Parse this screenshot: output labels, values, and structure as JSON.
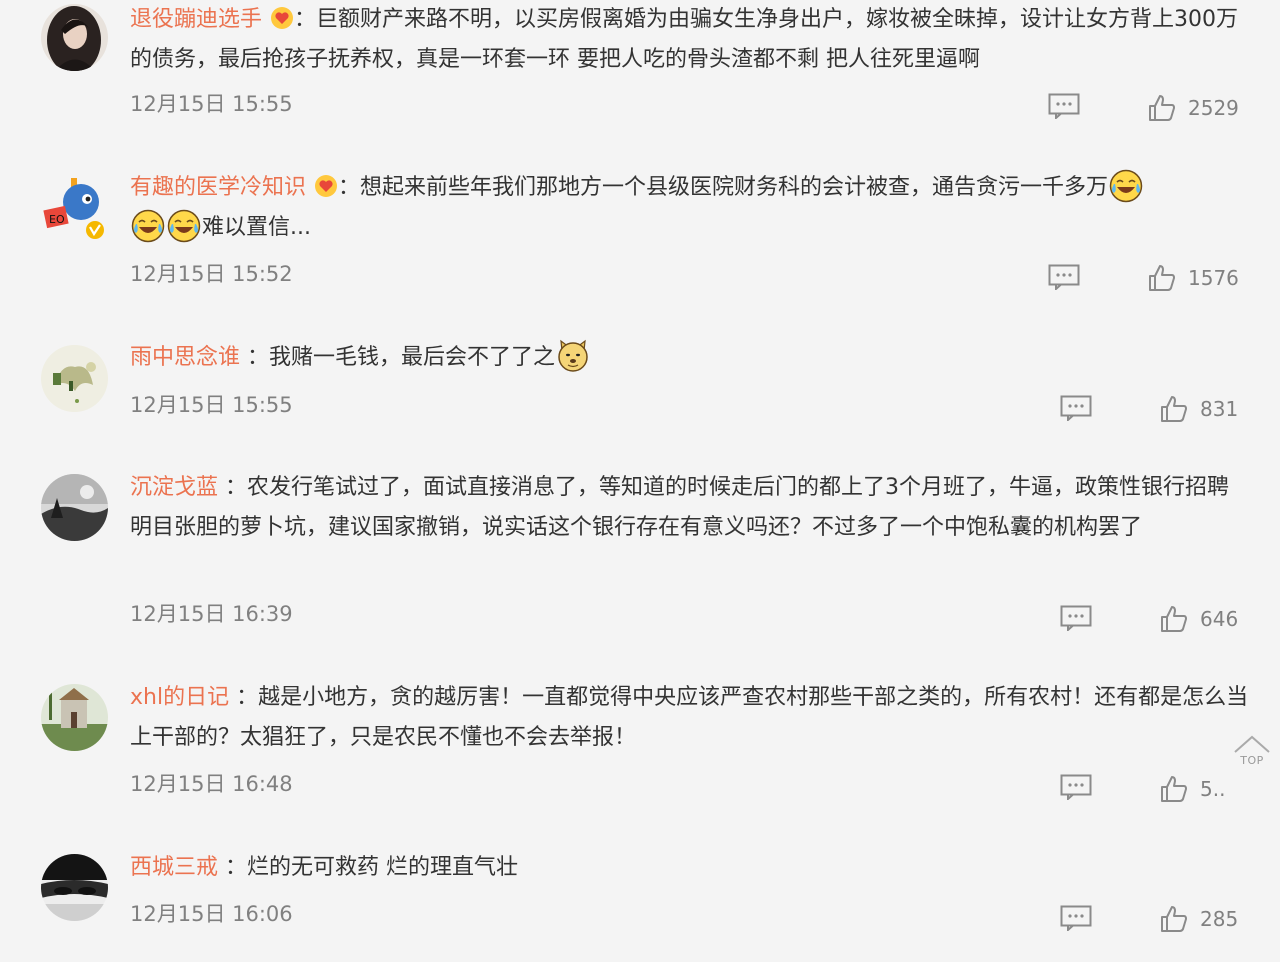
{
  "comments": [
    {
      "username": "退役蹦迪选手",
      "text_pre": "：巨额财产来路不明，以买房假离婚为由骗女生净身出户，嫁妆被全昧掉，设计让女方背上300万的债务，最后抢孩子抚养权，真是一环套一环 要把人吃的骨头渣都不剩 把人往死里逼啊",
      "time": "12月15日 15:55",
      "likes": "2529"
    },
    {
      "username": "有趣的医学冷知识",
      "text_pre": "：想起来前些年我们那地方一个县级医院财务科的会计被查，通告贪污一千多万",
      "text_post": "难以置信...",
      "time": "12月15日 15:52",
      "likes": "1576"
    },
    {
      "username": "雨中思念谁",
      "text_pre": "：我赌一毛钱，最后会不了了之",
      "time": "12月15日 15:55",
      "likes": "831"
    },
    {
      "username": "沉淀戈蓝",
      "text_pre": "：农发行笔试过了，面试直接消息了，等知道的时候走后门的都上了3个月班了，牛逼，政策性银行招聘明目张胆的萝卜坑，建议国家撤销，说实话这个银行存在有意义吗还？不过多了一个中饱私囊的机构罢了",
      "time": "12月15日 16:39",
      "likes": "646"
    },
    {
      "username": "xhl的日记",
      "text_pre": "：越是小地方，贪的越厉害！一直都觉得中央应该严查农村那些干部之类的，所有农村！还有都是怎么当上干部的？太猖狂了，只是农民不懂也不会去举报！",
      "time": "12月15日 16:48",
      "likes": "5.."
    },
    {
      "username": "西城三戒",
      "text_pre": "：烂的无可救药 烂的理直气壮",
      "time": "12月15日 16:06",
      "likes": "285"
    }
  ],
  "scroll_top_label": "TOP",
  "colors": {
    "username": "#eb7350",
    "text": "#333333",
    "meta": "#808080",
    "background": "#f4f4f4"
  },
  "icons": {
    "reply": "comment-reply-icon",
    "like": "thumbs-up-icon",
    "badge": "fan-heart-badge-icon",
    "verified": "verified-v-badge-icon",
    "emoji_laugh": "laugh-cry-emoji-icon",
    "emoji_doge": "doge-emoji-icon"
  }
}
